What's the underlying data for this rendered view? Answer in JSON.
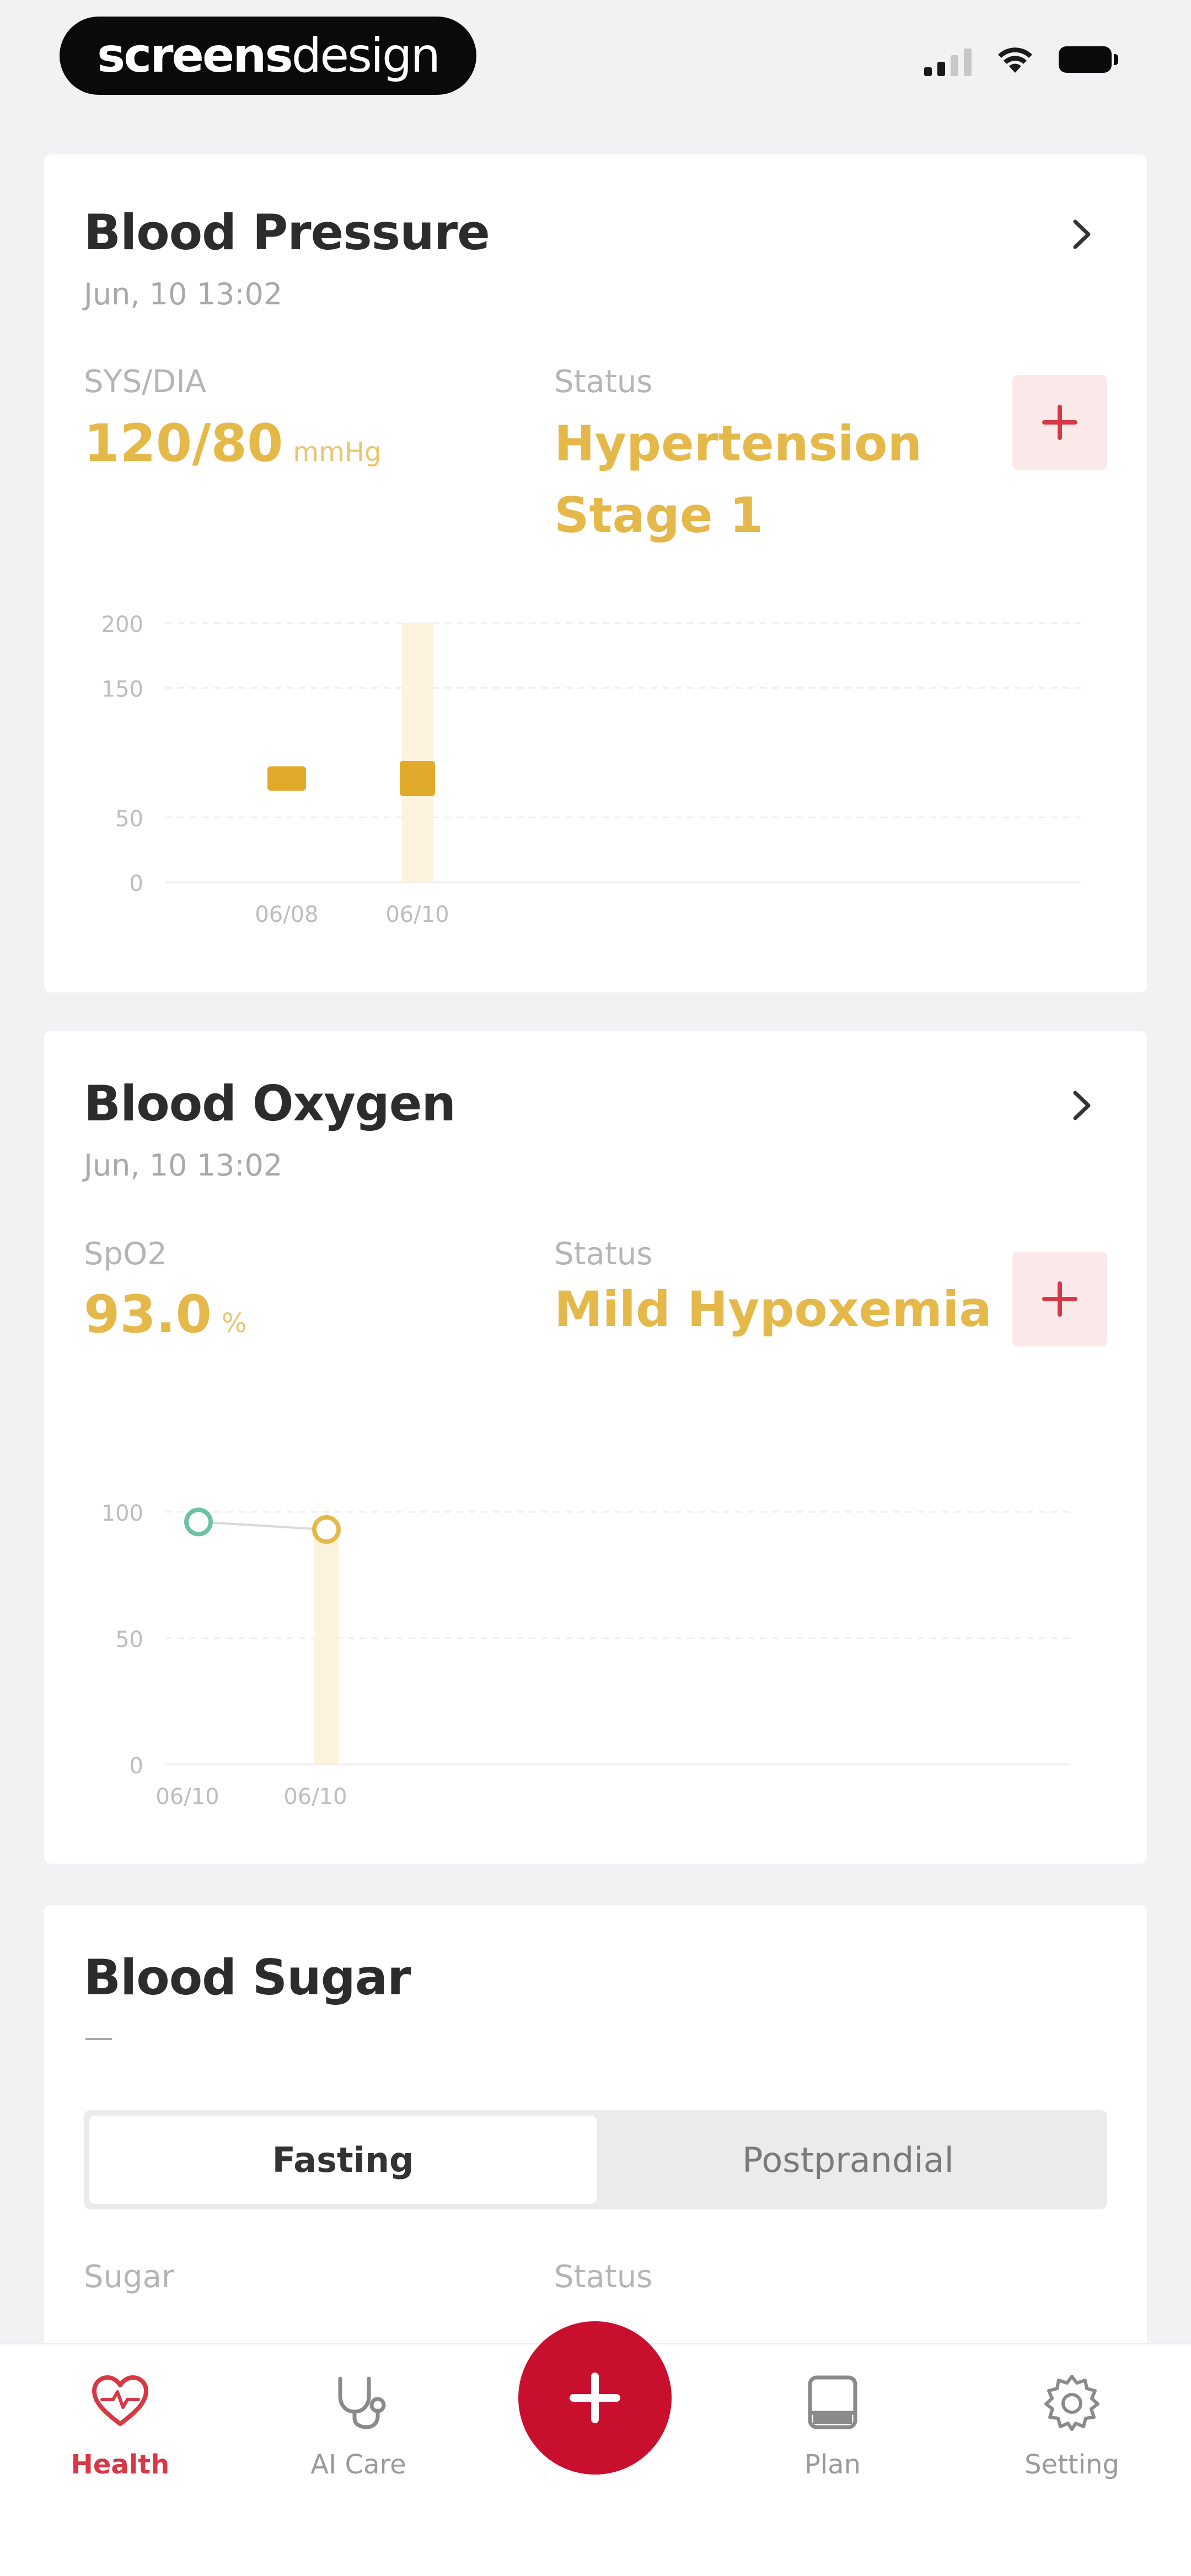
{
  "status_bar": {
    "brand_strong": "screens",
    "brand_light": "design"
  },
  "cards": {
    "blood_pressure": {
      "title": "Blood Pressure",
      "date": "Jun, 10 13:02",
      "metric_label": "SYS/DIA",
      "metric_value": "120/80",
      "metric_unit": "mmHg",
      "status_label": "Status",
      "status_line1": "Hypertension",
      "status_line2": "Stage 1",
      "chart_data": {
        "type": "bar",
        "categories": [
          "06/08",
          "06/10"
        ],
        "series": [
          {
            "values": [
              80,
              80
            ]
          }
        ],
        "ylim": [
          0,
          200
        ],
        "yticks": [
          "200",
          "150",
          "50",
          "0"
        ],
        "grid": true,
        "highlighted_category": "06/10"
      }
    },
    "blood_oxygen": {
      "title": "Blood Oxygen",
      "date": "Jun, 10 13:02",
      "metric_label": "SpO2",
      "metric_value": "93.0",
      "metric_unit": "%",
      "status_label": "Status",
      "status_line1": "Mild Hypoxemia",
      "chart_data": {
        "type": "line",
        "categories": [
          "06/10",
          "06/10"
        ],
        "series": [
          {
            "values": [
              96,
              93
            ],
            "point_colors": [
              "#6cc3a3",
              "#e5b84a"
            ]
          }
        ],
        "ylim": [
          0,
          100
        ],
        "yticks": [
          "100",
          "50",
          "0"
        ],
        "grid": true,
        "highlighted_category_index": 1
      }
    },
    "blood_sugar": {
      "title": "Blood Sugar",
      "date": "—",
      "segments": [
        "Fasting",
        "Postprandial"
      ],
      "active_segment": "Fasting",
      "metric_label": "Sugar",
      "status_label": "Status"
    }
  },
  "tabbar": {
    "tabs": [
      {
        "label": "Health",
        "icon": "heart-icon",
        "active": true
      },
      {
        "label": "AI Care",
        "icon": "stethoscope-icon",
        "active": false
      },
      {
        "label": "Plan",
        "icon": "plan-icon",
        "active": false
      },
      {
        "label": "Setting",
        "icon": "gear-icon",
        "active": false
      }
    ],
    "fab_icon": "plus-icon"
  },
  "colors": {
    "accent_red": "#c8102e",
    "warning_yellow": "#e5b84a",
    "normal_green": "#6cc3a3"
  }
}
